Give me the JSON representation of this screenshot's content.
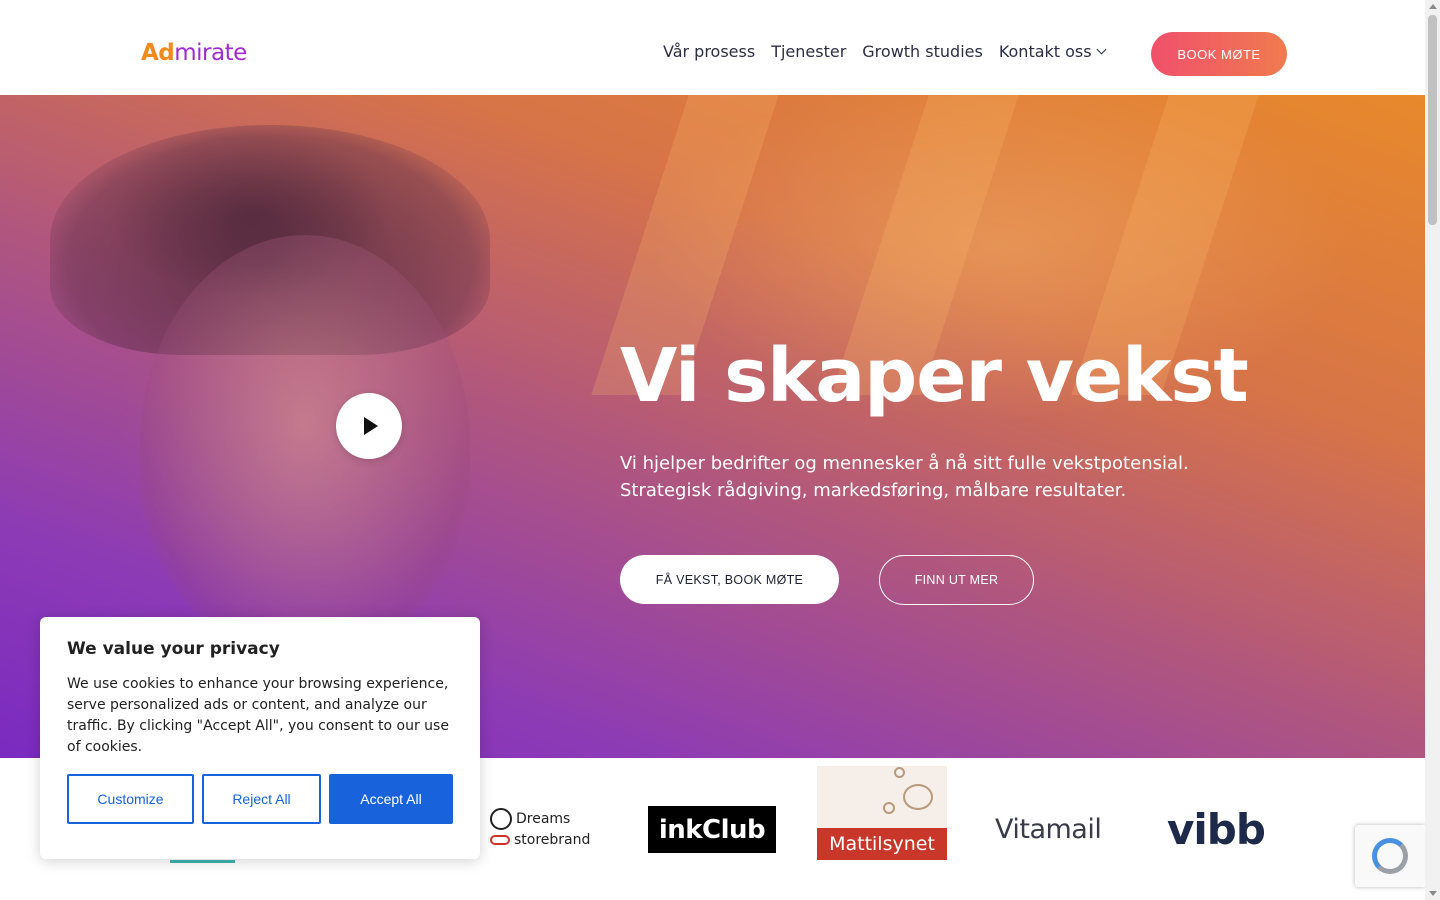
{
  "header": {
    "logo_ad": "Ad",
    "logo_rest": "mirate",
    "nav": [
      "Vår prosess",
      "Tjenester",
      "Growth studies",
      "Kontakt oss"
    ],
    "book_button": "BOOK MØTE"
  },
  "hero": {
    "title": "Vi skaper vekst",
    "subtitle": "Vi hjelper bedrifter og mennesker å nå sitt fulle vekstpotensial. Strategisk rådgiving, markedsføring, målbare resultater.",
    "cta_primary": "FÅ VEKST, BOOK MØTE",
    "cta_secondary": "FINN UT MER"
  },
  "logos": {
    "dreams": "Dreams",
    "storebrand": "storebrand",
    "inkclub": "inkClub",
    "mattilsynet": "Mattilsynet",
    "vitamail": "Vitamail",
    "vibb": "vibb"
  },
  "cookie": {
    "title": "We value your privacy",
    "text": "We use cookies to enhance your browsing experience, serve personalized ads or content, and analyze our traffic. By clicking \"Accept All\", you consent to our use of cookies.",
    "customize": "Customize",
    "reject": "Reject All",
    "accept": "Accept All"
  },
  "colors": {
    "accent_blue": "#1863dc",
    "book_gradient_start": "#f0506b",
    "book_gradient_end": "#f07b4f",
    "logo_orange": "#f08a1c",
    "logo_purple": "#a22bd3"
  }
}
